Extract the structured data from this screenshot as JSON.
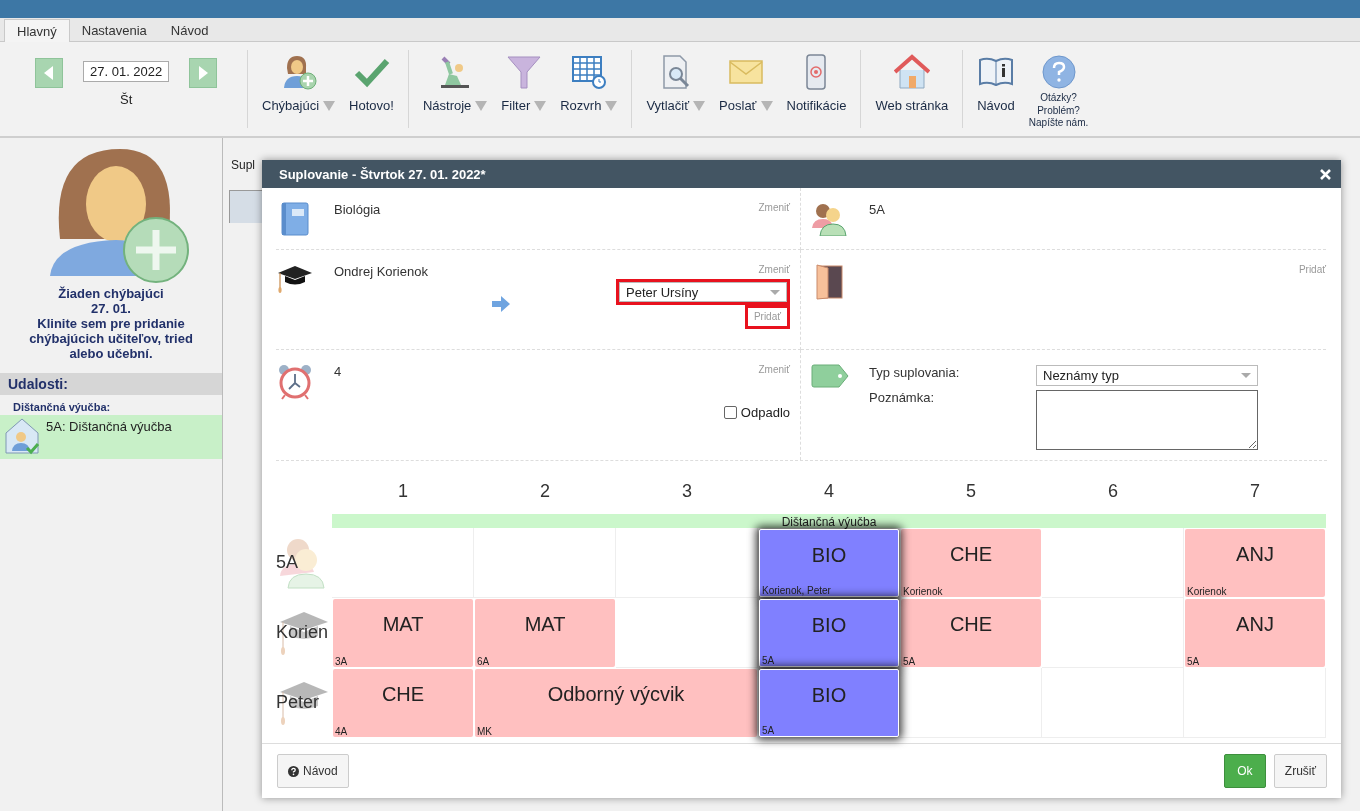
{
  "tabs": [
    {
      "label": "Hlavný",
      "selected": true
    },
    {
      "label": "Nastavenia",
      "selected": false
    },
    {
      "label": "Návod",
      "selected": false
    }
  ],
  "toolbar": {
    "date": {
      "value": "27. 01. 2022",
      "weekday": "Št"
    },
    "groups": [
      [
        {
          "label": "Chýbajúci",
          "dropdown": true
        },
        {
          "label": "Hotovo!",
          "dropdown": false
        }
      ],
      [
        {
          "label": "Nástroje",
          "dropdown": true
        },
        {
          "label": "Filter",
          "dropdown": true
        },
        {
          "label": "Rozvrh",
          "dropdown": true
        }
      ],
      [
        {
          "label": "Vytlačiť",
          "dropdown": true
        },
        {
          "label": "Poslať",
          "dropdown": true
        },
        {
          "label": "Notifikácie",
          "dropdown": false
        }
      ],
      [
        {
          "label": "Web stránka",
          "dropdown": false
        }
      ],
      [
        {
          "label": "Návod",
          "dropdown": false
        },
        {
          "label_lines": [
            "Otázky?",
            "Problém?",
            "Napíšte nám."
          ]
        }
      ]
    ]
  },
  "sidebar": {
    "title": "Žiaden chýbajúci",
    "date": "27. 01.",
    "hint": "Klinite sem pre pridanie chýbajúcich učiteľov, tried alebo učební.",
    "events_header": "Udalosti:",
    "event_group": "Dištančná výučba:",
    "events": [
      {
        "label": "5A: Dištančná výučba"
      }
    ]
  },
  "main": {
    "tab_label": "Supl"
  },
  "dialog": {
    "title": "Suplovanie - Štvrtok 27. 01. 2022*",
    "subject": {
      "value": "Biológia",
      "action": "Zmeniť"
    },
    "class": {
      "value": "5A"
    },
    "teacher": {
      "value": "Ondrej Korienok",
      "action": "Zmeniť",
      "substitute": "Peter Ursíny",
      "substitute_annotated": true,
      "add": "Pridať",
      "add_annotated": true
    },
    "room": {
      "add": "Pridať"
    },
    "period": {
      "value": "4",
      "action": "Zmeniť",
      "cancelled": {
        "label": "Odpadlo",
        "checked": false
      }
    },
    "type": {
      "label": "Typ suplovania:",
      "value": "Neznámy typ",
      "note_label": "Poznámka:"
    },
    "periods": [
      "1",
      "2",
      "3",
      "4",
      "5",
      "6",
      "7"
    ],
    "event_banner": "Dištančná výučba",
    "rows": [
      {
        "kind": "class",
        "label": "5A",
        "cells": [
          {
            "kind": "empty",
            "selected": false
          },
          {
            "kind": "empty",
            "selected": false
          },
          {
            "kind": "empty",
            "selected": false
          },
          {
            "kind": "lesson",
            "subject": "BIO",
            "sub": "Korienok, Peter",
            "selected": true
          },
          {
            "kind": "lesson",
            "subject": "CHE",
            "sub": "Korienok",
            "selected": false
          },
          {
            "kind": "empty",
            "selected": false
          },
          {
            "kind": "lesson",
            "subject": "ANJ",
            "sub": "Korienok",
            "selected": false
          }
        ]
      },
      {
        "kind": "teacher",
        "label": "Korien",
        "cells": [
          {
            "kind": "lesson",
            "subject": "MAT",
            "sub": "3A",
            "selected": false
          },
          {
            "kind": "lesson",
            "subject": "MAT",
            "sub": "6A",
            "selected": false
          },
          {
            "kind": "empty",
            "selected": false
          },
          {
            "kind": "lesson",
            "subject": "BIO",
            "sub": "5A",
            "selected": true
          },
          {
            "kind": "lesson",
            "subject": "CHE",
            "sub": "5A",
            "selected": false
          },
          {
            "kind": "empty",
            "selected": false
          },
          {
            "kind": "lesson",
            "subject": "ANJ",
            "sub": "5A",
            "selected": false
          }
        ]
      },
      {
        "kind": "teacher",
        "label": "Peter",
        "cells": [
          {
            "kind": "lesson",
            "subject": "CHE",
            "sub": "4A",
            "selected": false
          },
          {
            "kind": "double",
            "subject": "Odborný výcvik",
            "sub": "MK",
            "selected": false
          },
          {
            "kind": "lesson",
            "subject": "BIO",
            "sub": "5A",
            "selected": true
          },
          {
            "kind": "empty",
            "selected": false
          },
          {
            "kind": "empty",
            "selected": false
          },
          {
            "kind": "empty",
            "selected": false
          }
        ]
      }
    ],
    "buttons": {
      "help": "Návod",
      "ok": "Ok",
      "cancel": "Zrušiť"
    }
  }
}
